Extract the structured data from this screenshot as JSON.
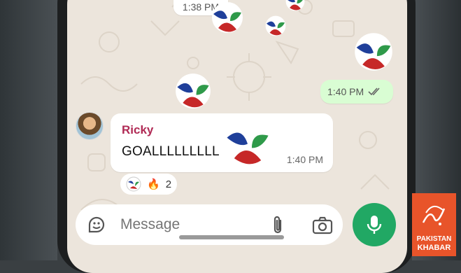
{
  "chat": {
    "top_time": "1:38 PM",
    "outgoing": {
      "time": "1:40 PM",
      "status_icon": "double-check-icon"
    },
    "incoming": {
      "sender": "Ricky",
      "text": "GOALLLLLLLLL",
      "time": "1:40 PM"
    },
    "reactions": {
      "emoji_fire": "🔥",
      "count": "2"
    }
  },
  "composer": {
    "placeholder": "Message",
    "icons": [
      "sticker-icon",
      "attach-icon",
      "camera-icon",
      "mic-icon"
    ]
  },
  "watermark": {
    "line1": "PAKISTAN",
    "line2": "KHABAR"
  },
  "colors": {
    "accent": "#21a864",
    "outgoing_bubble": "#d9fdd3",
    "sender": "#b02a55",
    "brand": "#e8542a"
  }
}
